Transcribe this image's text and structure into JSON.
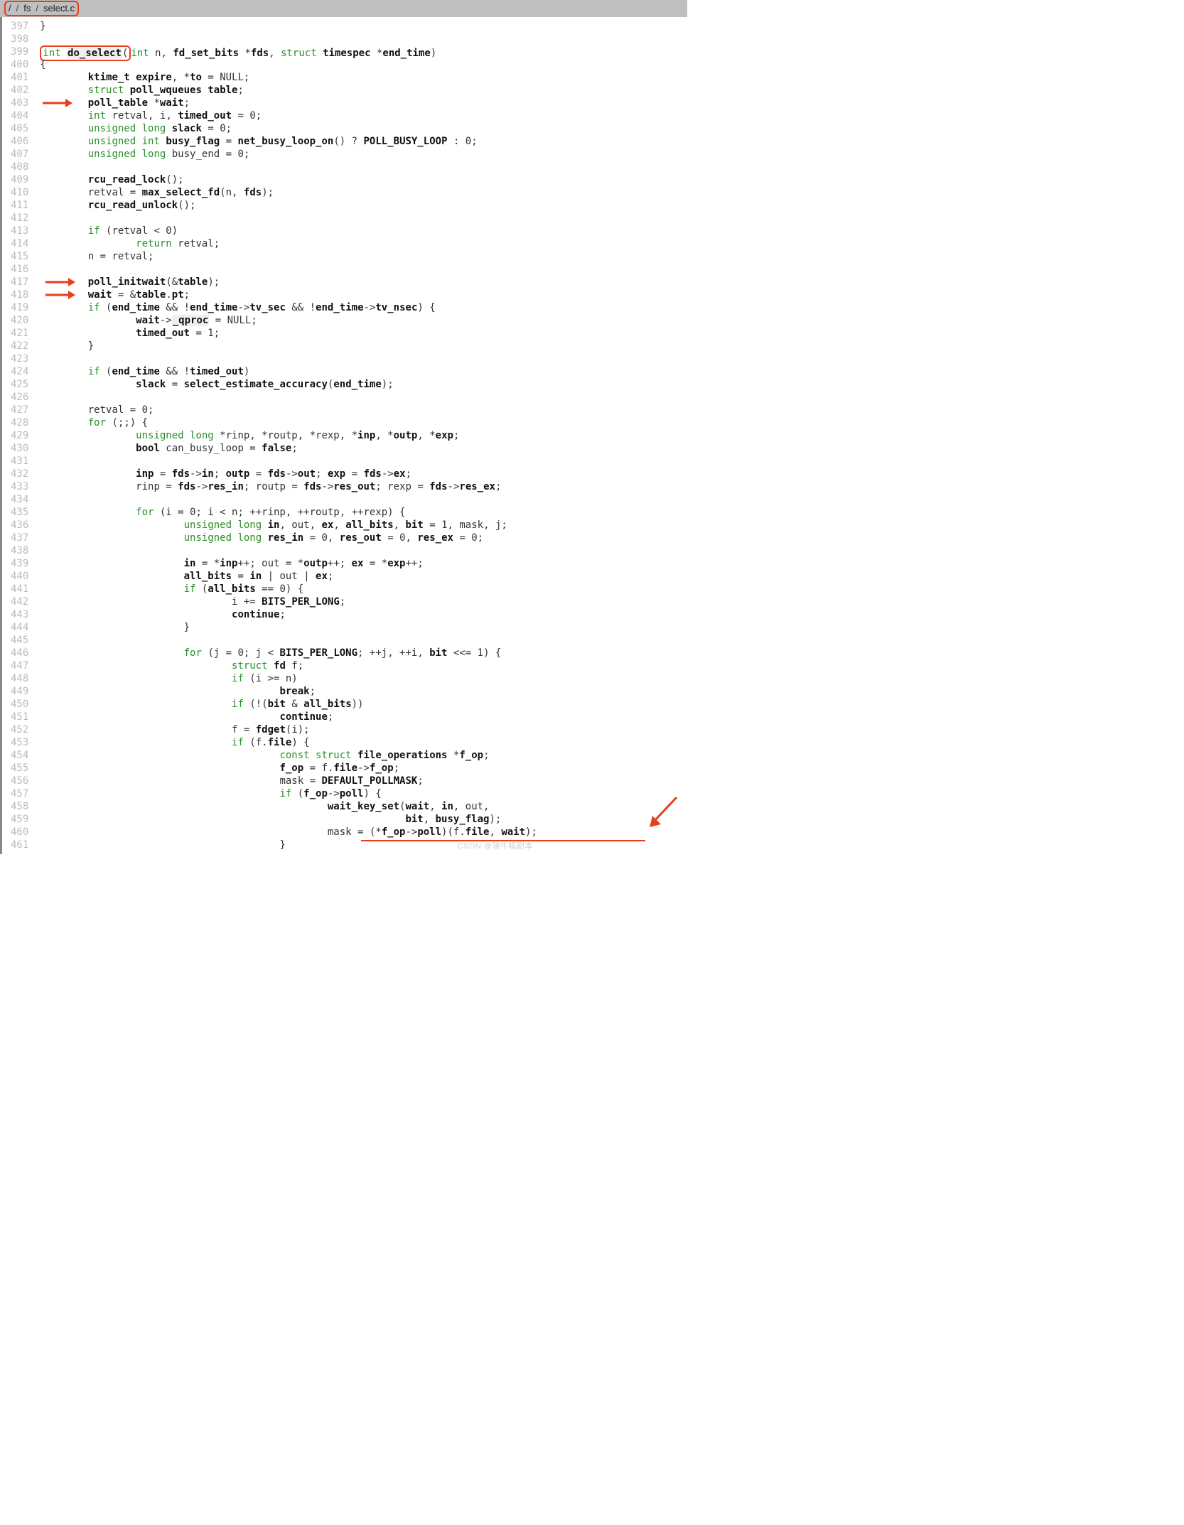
{
  "breadcrumb": {
    "root": "/",
    "dir": "fs",
    "file": "select.c"
  },
  "line_start": 397,
  "line_end": 461,
  "lines": {
    "397": "}",
    "398": "",
    "399_pre": "",
    "399_sig_int": "int",
    "399_sig_fn": "do_select",
    "399_sig_open": "(",
    "399_rest_a": "int",
    "399_rest_b": " n, ",
    "399_rest_c": "fd_set_bits",
    "399_rest_d": " *",
    "399_rest_e": "fds",
    "399_rest_f": ", ",
    "399_rest_g": "struct",
    "399_rest_h": " ",
    "399_rest_i": "timespec",
    "399_rest_j": " *",
    "399_rest_k": "end_time",
    "399_rest_l": ")",
    "400": "{",
    "401_a": "        ",
    "401_b": "ktime_t",
    "401_c": " ",
    "401_d": "expire",
    "401_e": ", *",
    "401_f": "to",
    "401_g": " = NULL;",
    "402_a": "        ",
    "402_b": "struct",
    "402_c": " ",
    "402_d": "poll_wqueues",
    "402_e": " ",
    "402_f": "table",
    "402_g": ";",
    "403_a": "        ",
    "403_b": "poll_table",
    "403_c": " *",
    "403_d": "wait",
    "403_e": ";",
    "404_a": "        ",
    "404_b": "int",
    "404_c": " retval, i, ",
    "404_d": "timed_out",
    "404_e": " = 0;",
    "405_a": "        ",
    "405_b": "unsigned long",
    "405_c": " ",
    "405_d": "slack",
    "405_e": " = 0;",
    "406_a": "        ",
    "406_b": "unsigned int",
    "406_c": " ",
    "406_d": "busy_flag",
    "406_e": " = ",
    "406_f": "net_busy_loop_on",
    "406_g": "() ? ",
    "406_h": "POLL_BUSY_LOOP",
    "406_i": " : 0;",
    "407_a": "        ",
    "407_b": "unsigned long",
    "407_c": " busy_end = 0;",
    "408": "",
    "409_a": "        ",
    "409_b": "rcu_read_lock",
    "409_c": "();",
    "410_a": "        retval = ",
    "410_b": "max_select_fd",
    "410_c": "(n, ",
    "410_d": "fds",
    "410_e": ");",
    "411_a": "        ",
    "411_b": "rcu_read_unlock",
    "411_c": "();",
    "412": "",
    "413_a": "        ",
    "413_b": "if",
    "413_c": " (retval < 0)",
    "414_a": "                ",
    "414_b": "return",
    "414_c": " retval;",
    "415": "        n = retval;",
    "416": "",
    "417_a": "        ",
    "417_b": "poll_initwait",
    "417_c": "(&",
    "417_d": "table",
    "417_e": ");",
    "418_a": "        ",
    "418_b": "wait",
    "418_c": " = &",
    "418_d": "table",
    "418_e": ".",
    "418_f": "pt",
    "418_g": ";",
    "419_a": "        ",
    "419_b": "if",
    "419_c": " (",
    "419_d": "end_time",
    "419_e": " && !",
    "419_f": "end_time",
    "419_g": "->",
    "419_h": "tv_sec",
    "419_i": " && !",
    "419_j": "end_time",
    "419_k": "->",
    "419_l": "tv_nsec",
    "419_m": ") {",
    "420_a": "                ",
    "420_b": "wait",
    "420_c": "->",
    "420_d": "_qproc",
    "420_e": " = NULL;",
    "421_a": "                ",
    "421_b": "timed_out",
    "421_c": " = 1;",
    "422": "        }",
    "423": "",
    "424_a": "        ",
    "424_b": "if",
    "424_c": " (",
    "424_d": "end_time",
    "424_e": " && !",
    "424_f": "timed_out",
    "424_g": ")",
    "425_a": "                ",
    "425_b": "slack",
    "425_c": " = ",
    "425_d": "select_estimate_accuracy",
    "425_e": "(",
    "425_f": "end_time",
    "425_g": ");",
    "426": "",
    "427": "        retval = 0;",
    "428_a": "        ",
    "428_b": "for",
    "428_c": " (;;) {",
    "429_a": "                ",
    "429_b": "unsigned long",
    "429_c": " *rinp, *routp, *rexp, *",
    "429_d": "inp",
    "429_e": ", *",
    "429_f": "outp",
    "429_g": ", *",
    "429_h": "exp",
    "429_i": ";",
    "430_a": "                ",
    "430_b": "bool",
    "430_c": " can_busy_loop = ",
    "430_d": "false",
    "430_e": ";",
    "431": "",
    "432_a": "                ",
    "432_b": "inp",
    "432_c": " = ",
    "432_d": "fds",
    "432_e": "->",
    "432_f": "in",
    "432_g": "; ",
    "432_h": "outp",
    "432_i": " = ",
    "432_j": "fds",
    "432_k": "->",
    "432_l": "out",
    "432_m": "; ",
    "432_n": "exp",
    "432_o": " = ",
    "432_p": "fds",
    "432_q": "->",
    "432_r": "ex",
    "432_s": ";",
    "433_a": "                rinp = ",
    "433_b": "fds",
    "433_c": "->",
    "433_d": "res_in",
    "433_e": "; routp = ",
    "433_f": "fds",
    "433_g": "->",
    "433_h": "res_out",
    "433_i": "; rexp = ",
    "433_j": "fds",
    "433_k": "->",
    "433_l": "res_ex",
    "433_m": ";",
    "434": "",
    "435_a": "                ",
    "435_b": "for",
    "435_c": " (i = 0; i < n; ++rinp, ++routp, ++rexp) {",
    "436_a": "                        ",
    "436_b": "unsigned long",
    "436_c": " ",
    "436_d": "in",
    "436_e": ", out, ",
    "436_f": "ex",
    "436_g": ", ",
    "436_h": "all_bits",
    "436_i": ", ",
    "436_j": "bit",
    "436_k": " = 1, mask, j;",
    "437_a": "                        ",
    "437_b": "unsigned long",
    "437_c": " ",
    "437_d": "res_in",
    "437_e": " = 0, ",
    "437_f": "res_out",
    "437_g": " = 0, ",
    "437_h": "res_ex",
    "437_i": " = 0;",
    "438": "",
    "439_a": "                        ",
    "439_b": "in",
    "439_c": " = *",
    "439_d": "inp",
    "439_e": "++; out = *",
    "439_f": "outp",
    "439_g": "++; ",
    "439_h": "ex",
    "439_i": " = *",
    "439_j": "exp",
    "439_k": "++;",
    "440_a": "                        ",
    "440_b": "all_bits",
    "440_c": " = ",
    "440_d": "in",
    "440_e": " | out | ",
    "440_f": "ex",
    "440_g": ";",
    "441_a": "                        ",
    "441_b": "if",
    "441_c": " (",
    "441_d": "all_bits",
    "441_e": " == 0) {",
    "442_a": "                                i += ",
    "442_b": "BITS_PER_LONG",
    "442_c": ";",
    "443_a": "                                ",
    "443_b": "continue",
    "443_c": ";",
    "444": "                        }",
    "445": "",
    "446_a": "                        ",
    "446_b": "for",
    "446_c": " (j = 0; j < ",
    "446_d": "BITS_PER_LONG",
    "446_e": "; ++j, ++i, ",
    "446_f": "bit",
    "446_g": " <<= 1) {",
    "447_a": "                                ",
    "447_b": "struct",
    "447_c": " ",
    "447_d": "fd",
    "447_e": " f;",
    "448_a": "                                ",
    "448_b": "if",
    "448_c": " (i >= n)",
    "449_a": "                                        ",
    "449_b": "break",
    "449_c": ";",
    "450_a": "                                ",
    "450_b": "if",
    "450_c": " (!(",
    "450_d": "bit",
    "450_e": " & ",
    "450_f": "all_bits",
    "450_g": "))",
    "451_a": "                                        ",
    "451_b": "continue",
    "451_c": ";",
    "452_a": "                                f = ",
    "452_b": "fdget",
    "452_c": "(i);",
    "453_a": "                                ",
    "453_b": "if",
    "453_c": " (f.",
    "453_d": "file",
    "453_e": ") {",
    "454_a": "                                        ",
    "454_b": "const struct",
    "454_c": " ",
    "454_d": "file_operations",
    "454_e": " *",
    "454_f": "f_op",
    "454_g": ";",
    "455_a": "                                        ",
    "455_b": "f_op",
    "455_c": " = f.",
    "455_d": "file",
    "455_e": "->",
    "455_f": "f_op",
    "455_g": ";",
    "456_a": "                                        mask = ",
    "456_b": "DEFAULT_POLLMASK",
    "456_c": ";",
    "457_a": "                                        ",
    "457_b": "if",
    "457_c": " (",
    "457_d": "f_op",
    "457_e": "->",
    "457_f": "poll",
    "457_g": ") {",
    "458_a": "                                                ",
    "458_b": "wait_key_set",
    "458_c": "(",
    "458_d": "wait",
    "458_e": ", ",
    "458_f": "in",
    "458_g": ", out,",
    "459_a": "                                                             ",
    "459_b": "bit",
    "459_c": ", ",
    "459_d": "busy_flag",
    "459_e": ");",
    "460_a": "                                                mask = (*",
    "460_b": "f_op",
    "460_c": "->",
    "460_d": "poll",
    "460_e": ")(f.",
    "460_f": "file",
    "460_g": ", ",
    "460_h": "wait",
    "460_i": ");",
    "461": "                                        }"
  },
  "watermark": "CSDN @骑牛唱剧本"
}
